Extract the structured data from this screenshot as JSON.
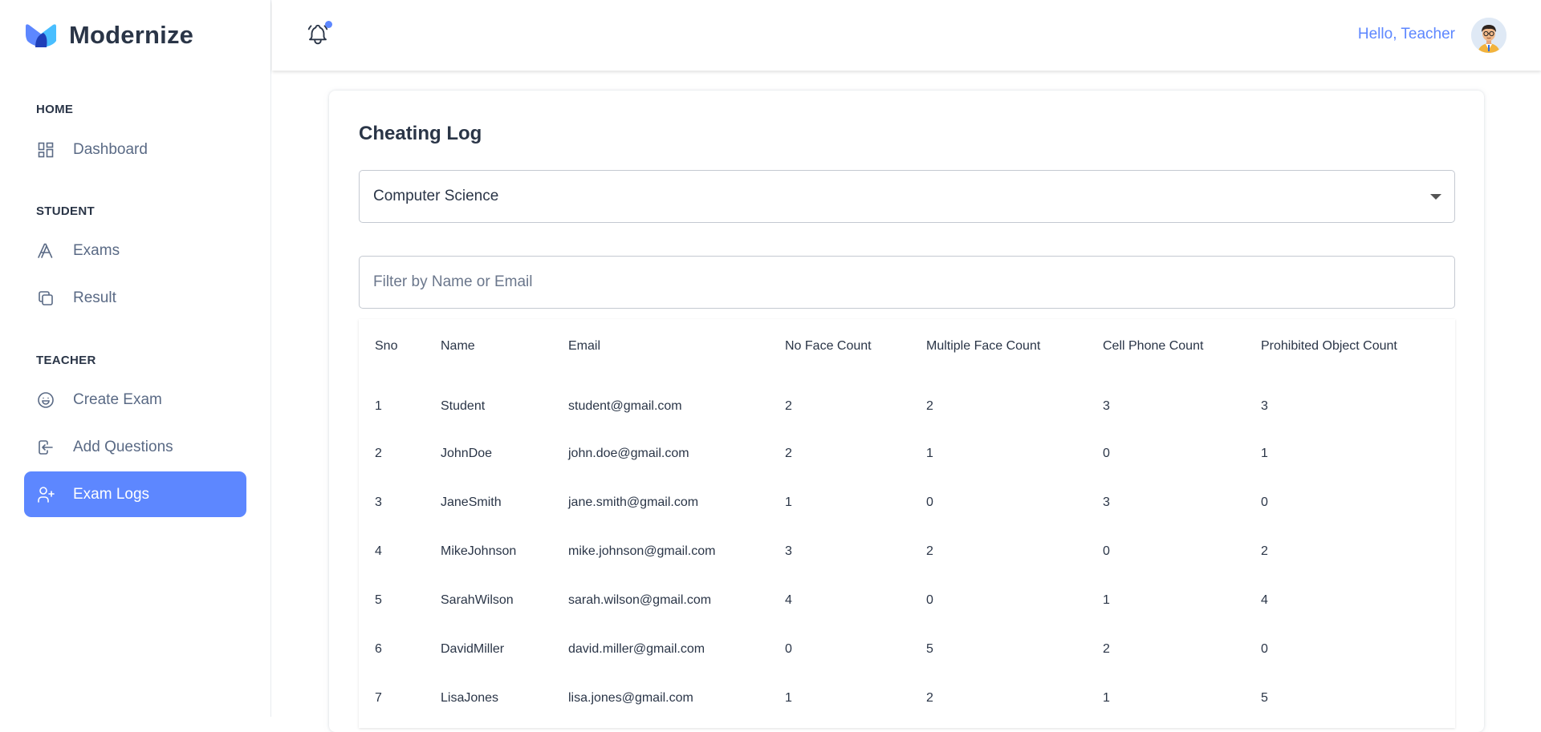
{
  "brand": {
    "name": "Modernize"
  },
  "sidebar": {
    "sections": [
      {
        "label": "HOME",
        "items": [
          {
            "label": "Dashboard",
            "icon": "dashboard-icon"
          }
        ]
      },
      {
        "label": "STUDENT",
        "items": [
          {
            "label": "Exams",
            "icon": "typography-icon"
          },
          {
            "label": "Result",
            "icon": "copy-icon"
          }
        ]
      },
      {
        "label": "TEACHER",
        "items": [
          {
            "label": "Create Exam",
            "icon": "mood-happy-icon"
          },
          {
            "label": "Add Questions",
            "icon": "login-icon"
          },
          {
            "label": "Exam Logs",
            "icon": "user-plus-icon",
            "active": true
          }
        ]
      }
    ]
  },
  "header": {
    "greeting": "Hello, Teacher",
    "notifications_icon": "bell-icon"
  },
  "main": {
    "title": "Cheating Log",
    "exam_select": {
      "value": "Computer Science"
    },
    "filter": {
      "placeholder": "Filter by Name or Email",
      "value": ""
    },
    "table": {
      "columns": [
        "Sno",
        "Name",
        "Email",
        "No Face Count",
        "Multiple Face Count",
        "Cell Phone Count",
        "Prohibited Object Count"
      ],
      "rows": [
        [
          "1",
          "Student",
          "student@gmail.com",
          "2",
          "2",
          "3",
          "3"
        ],
        [
          "2",
          "JohnDoe",
          "john.doe@gmail.com",
          "2",
          "1",
          "0",
          "1"
        ],
        [
          "3",
          "JaneSmith",
          "jane.smith@gmail.com",
          "1",
          "0",
          "3",
          "0"
        ],
        [
          "4",
          "MikeJohnson",
          "mike.johnson@gmail.com",
          "3",
          "2",
          "0",
          "2"
        ],
        [
          "5",
          "SarahWilson",
          "sarah.wilson@gmail.com",
          "4",
          "0",
          "1",
          "4"
        ],
        [
          "6",
          "DavidMiller",
          "david.miller@gmail.com",
          "0",
          "5",
          "2",
          "0"
        ],
        [
          "7",
          "LisaJones",
          "lisa.jones@gmail.com",
          "1",
          "2",
          "1",
          "5"
        ]
      ]
    }
  },
  "colors": {
    "accent": "#5d87ff",
    "text": "#2a3547",
    "muted": "#5a6a85"
  }
}
